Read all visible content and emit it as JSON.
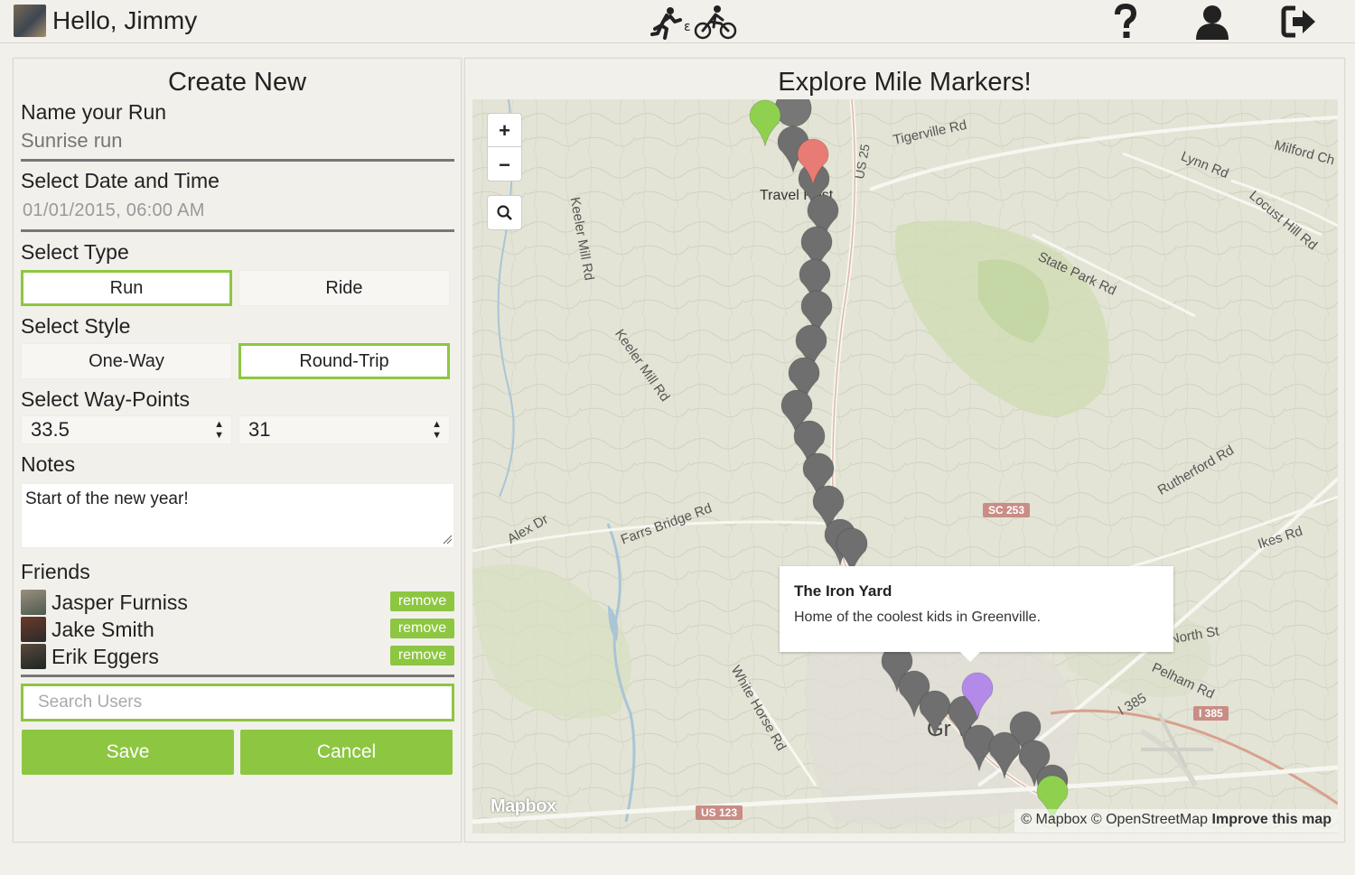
{
  "header": {
    "greeting": "Hello, Jimmy",
    "logo_icon": "run-bike-icon",
    "help_icon": "question-icon",
    "profile_icon": "user-icon",
    "logout_icon": "sign-out-icon"
  },
  "create": {
    "title": "Create New",
    "name_label": "Name your Run",
    "name_placeholder": "Sunrise run",
    "date_label": "Select Date and Time",
    "date_value": "01/01/2015, 06:00 AM",
    "type_label": "Select Type",
    "type_options": [
      "Run",
      "Ride"
    ],
    "type_selected": "Run",
    "style_label": "Select Style",
    "style_options": [
      "One-Way",
      "Round-Trip"
    ],
    "style_selected": "Round-Trip",
    "waypoints_label": "Select Way-Points",
    "waypoint_start": "33.5",
    "waypoint_end": "31",
    "notes_label": "Notes",
    "notes_value": "Start of the new year!",
    "friends_label": "Friends",
    "friends": [
      {
        "name": "Jasper Furniss",
        "action": "remove"
      },
      {
        "name": "Jake Smith",
        "action": "remove"
      },
      {
        "name": "Erik Eggers",
        "action": "remove"
      }
    ],
    "search_placeholder": "Search Users",
    "save_label": "Save",
    "cancel_label": "Cancel"
  },
  "explore": {
    "title": "Explore Mile Markers!",
    "zoom_in": "+",
    "zoom_out": "−",
    "popup_title": "The Iron Yard",
    "popup_desc": "Home of the coolest kids in Greenville.",
    "mapbox_logo": "Mapbox",
    "attribution_1": "© Mapbox © OpenStreetMap",
    "attribution_2": "Improve this map",
    "labels": {
      "tigerville": "Tigerville Rd",
      "milford": "Milford Ch",
      "lynn": "Lynn Rd",
      "locust": "Locust Hill Rd",
      "keeler1": "Keeler Mill Rd",
      "keeler2": "Keeler Mill Rd",
      "state_park": "State Park Rd",
      "travelers": "Travel   Rest",
      "us25": "US 25",
      "rutherford": "Rutherford Rd",
      "ikes": "Ikes Rd",
      "alex": "Alex Dr",
      "farrs": "Farrs Bridge Rd",
      "sc253": "SC 253",
      "north": "North St",
      "pelham": "Pelham Rd",
      "i385": "I 385",
      "i385b": "I 385",
      "whitehorse": "White Horse Rd",
      "us123": "US 123",
      "greenville": "Gr   vi"
    }
  }
}
